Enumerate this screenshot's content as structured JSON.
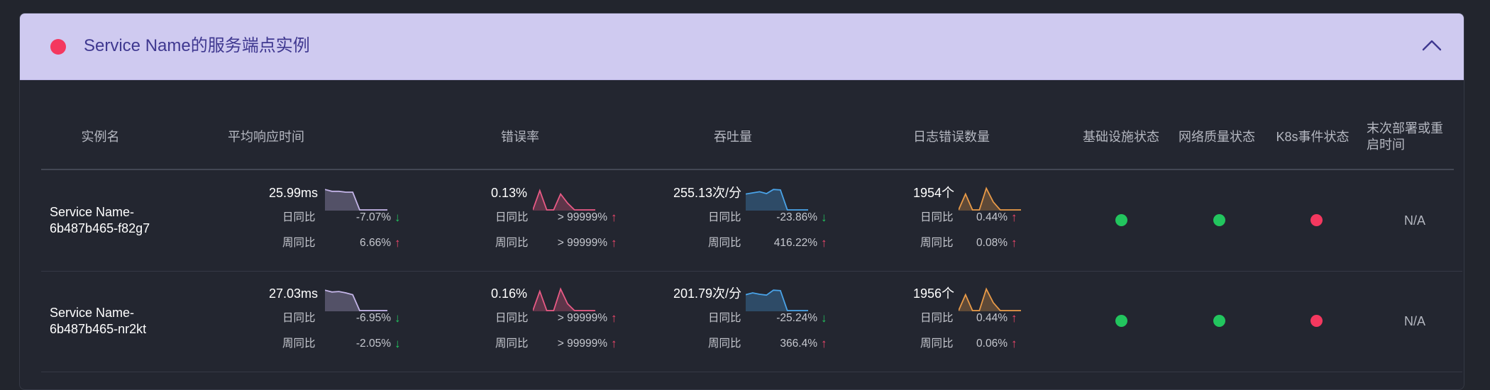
{
  "panel": {
    "title": "Service Name的服务端点实例",
    "status_color": "#f4385f",
    "collapse_icon": "chevron-up-icon"
  },
  "columns": [
    "实例名",
    "平均响应时间",
    "错误率",
    "吞吐量",
    "日志错误数量",
    "基础设施状态",
    "网络质量状态",
    "K8s事件状态",
    "末次部署或重启时间"
  ],
  "labels": {
    "day": "日同比",
    "week": "周同比"
  },
  "colors": {
    "ok": "#22c55e",
    "alert": "#f4385f",
    "latency_line": "#c4b5e8",
    "error_line": "#e85a85",
    "throughput_line": "#4aa3e8",
    "log_line": "#e89a48"
  },
  "rows": [
    {
      "instance": "Service Name-6b487b465-f82g7",
      "latency": {
        "value": "25.99ms",
        "day": "-7.07%",
        "day_dir": "down",
        "week": "6.66%",
        "week_dir": "up",
        "spark": [
          0.9,
          0.82,
          0.82,
          0.78,
          0.78,
          0.0,
          0.0,
          0.0,
          0.0,
          0.0
        ]
      },
      "error_rate": {
        "value": "0.13%",
        "day": "> 99999%",
        "day_dir": "up",
        "week": "> 99999%",
        "week_dir": "up",
        "spark": [
          0.0,
          0.85,
          0.0,
          0.0,
          0.7,
          0.3,
          0.0,
          0.0,
          0.0,
          0.0
        ]
      },
      "throughput": {
        "value": "255.13次/分",
        "day": "-23.86%",
        "day_dir": "down",
        "week": "416.22%",
        "week_dir": "up",
        "spark": [
          0.7,
          0.75,
          0.8,
          0.72,
          0.9,
          0.88,
          0.0,
          0.0,
          0.0,
          0.0
        ]
      },
      "log_errors": {
        "value": "1954个",
        "day": "0.44%",
        "day_dir": "up",
        "week": "0.08%",
        "week_dir": "up",
        "spark": [
          0.0,
          0.7,
          0.0,
          0.0,
          0.95,
          0.35,
          0.0,
          0.0,
          0.0,
          0.0
        ]
      },
      "infra": "ok",
      "network": "ok",
      "k8s": "alert",
      "deploy_time": "N/A"
    },
    {
      "instance": "Service Name-6b487b465-nr2kt",
      "latency": {
        "value": "27.03ms",
        "day": "-6.95%",
        "day_dir": "down",
        "week": "-2.05%",
        "week_dir": "down",
        "spark": [
          0.9,
          0.82,
          0.84,
          0.78,
          0.7,
          0.0,
          0.0,
          0.0,
          0.0,
          0.0
        ]
      },
      "error_rate": {
        "value": "0.16%",
        "day": "> 99999%",
        "day_dir": "up",
        "week": "> 99999%",
        "week_dir": "up",
        "spark": [
          0.0,
          0.85,
          0.0,
          0.0,
          0.95,
          0.3,
          0.0,
          0.0,
          0.0,
          0.0
        ]
      },
      "throughput": {
        "value": "201.79次/分",
        "day": "-25.24%",
        "day_dir": "down",
        "week": "366.4%",
        "week_dir": "up",
        "spark": [
          0.7,
          0.78,
          0.72,
          0.68,
          0.9,
          0.88,
          0.0,
          0.0,
          0.0,
          0.0
        ]
      },
      "log_errors": {
        "value": "1956个",
        "day": "0.44%",
        "day_dir": "up",
        "week": "0.06%",
        "week_dir": "up",
        "spark": [
          0.0,
          0.7,
          0.0,
          0.0,
          0.95,
          0.35,
          0.0,
          0.0,
          0.0,
          0.0
        ]
      },
      "infra": "ok",
      "network": "ok",
      "k8s": "alert",
      "deploy_time": "N/A"
    }
  ]
}
